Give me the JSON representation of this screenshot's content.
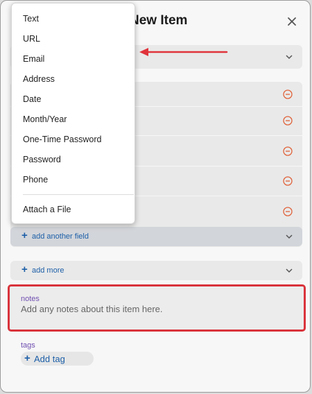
{
  "dialog": {
    "title": "New Item",
    "close_icon": "close-icon"
  },
  "field_type_menu": {
    "items": [
      "Text",
      "URL",
      "Email",
      "Address",
      "Date",
      "Month/Year",
      "One-Time Password",
      "Password",
      "Phone"
    ],
    "attach_label": "Attach a File"
  },
  "sections": {
    "add_another_field": "add another field",
    "add_more": "add more"
  },
  "notes": {
    "label": "notes",
    "placeholder": "Add any notes about this item here."
  },
  "tags": {
    "label": "tags",
    "add_label": "Add tag"
  },
  "annotations": {
    "arrow_color": "#e0333b",
    "highlight_color": "#d9333b"
  },
  "colors": {
    "accent": "#1d5fa8",
    "remove": "#e0633b",
    "label_purple": "#6f4fb0"
  }
}
